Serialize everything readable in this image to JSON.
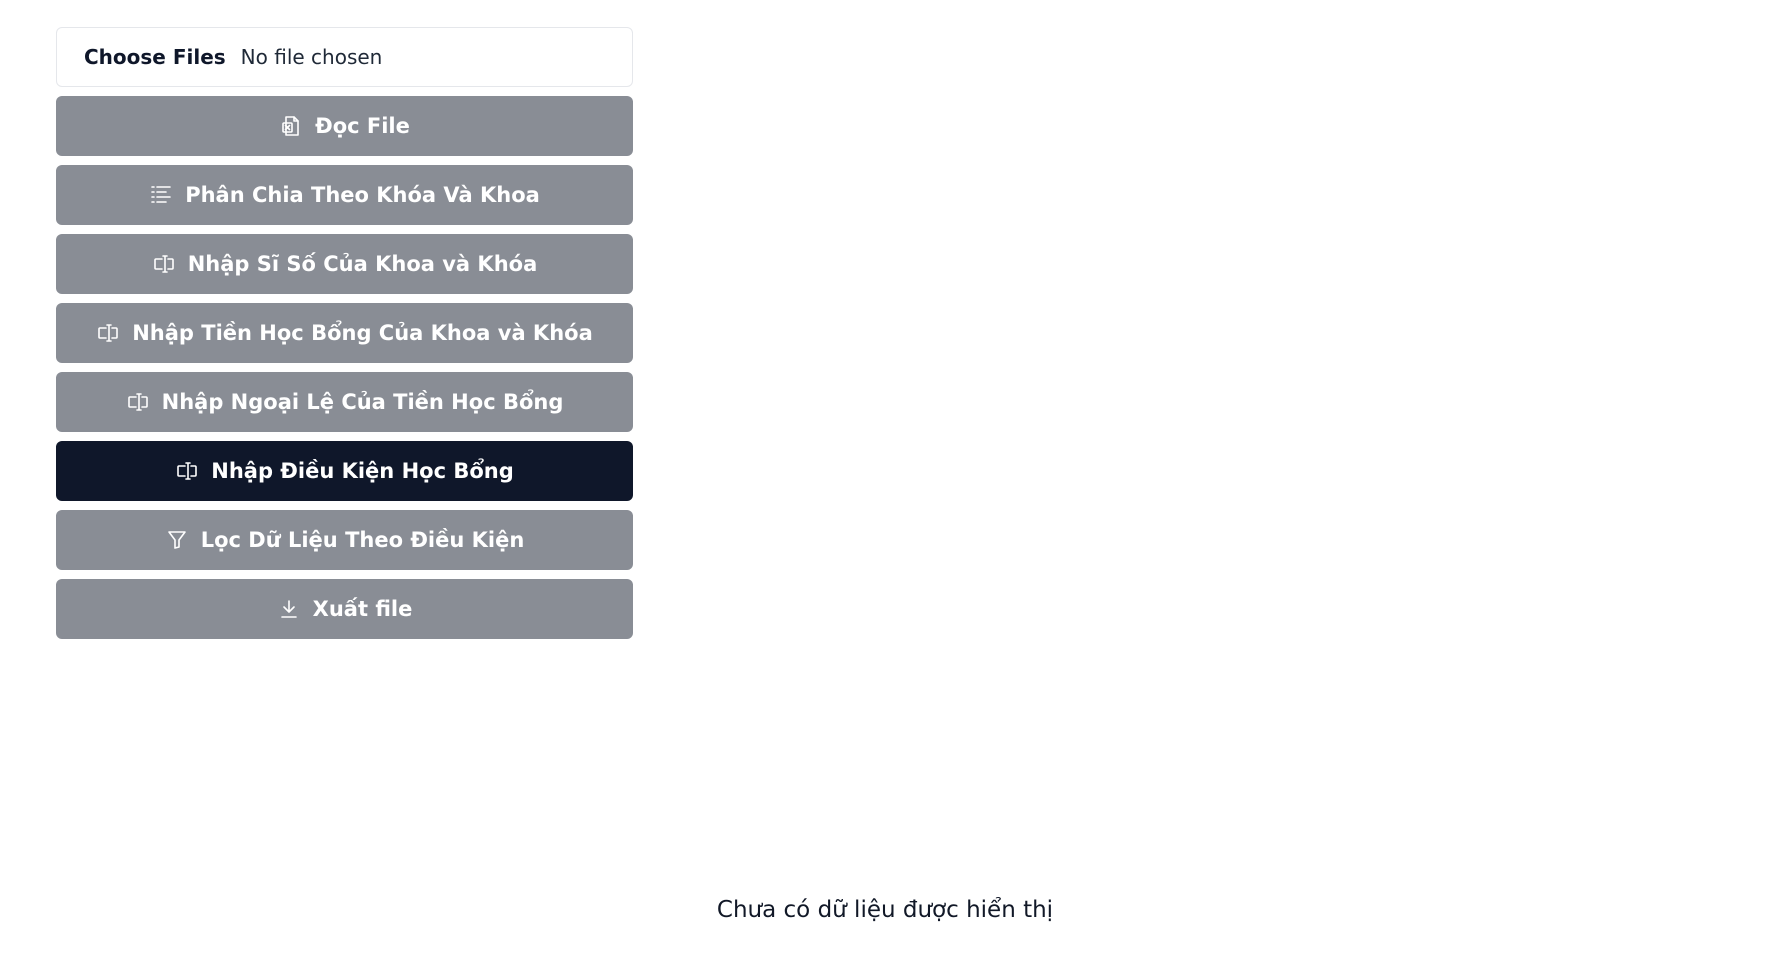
{
  "file_input": {
    "button_label": "Choose Files",
    "status": "No file chosen"
  },
  "actions": [
    {
      "label": "Đọc File",
      "icon": "excel-file-icon",
      "active": false
    },
    {
      "label": "Phân Chia Theo Khóa Và Khoa",
      "icon": "list-icon",
      "active": false
    },
    {
      "label": "Nhập Sĩ Số Của Khoa và Khóa",
      "icon": "text-input-icon",
      "active": false
    },
    {
      "label": "Nhập Tiền Học Bổng Của Khoa và Khóa",
      "icon": "text-input-icon",
      "active": false
    },
    {
      "label": "Nhập Ngoại Lệ Của Tiền Học Bổng",
      "icon": "text-input-icon",
      "active": false
    },
    {
      "label": "Nhập Điều Kiện Học Bổng",
      "icon": "text-input-icon",
      "active": true
    },
    {
      "label": "Lọc Dữ Liệu Theo Điều Kiện",
      "icon": "filter-icon",
      "active": false
    },
    {
      "label": "Xuất file",
      "icon": "download-icon",
      "active": false
    }
  ],
  "colors": {
    "button_default": "#898d95",
    "button_active": "#0f172a"
  },
  "empty_message": "Chưa có dữ liệu được hiển thị"
}
